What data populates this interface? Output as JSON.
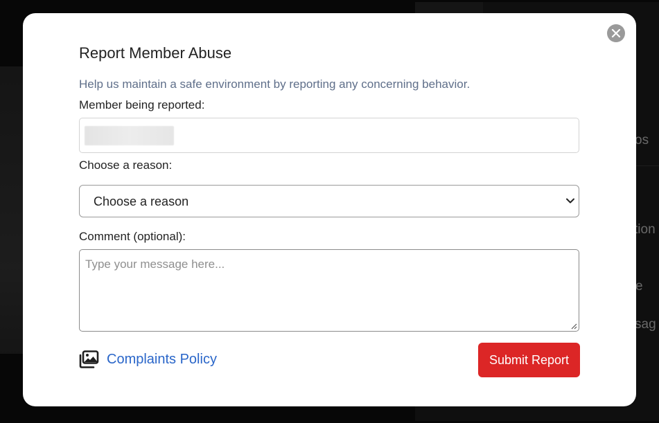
{
  "background": {
    "fragments": [
      "os",
      "tion",
      "e",
      "sag"
    ]
  },
  "modal": {
    "title": "Report Member Abuse",
    "subtitle": "Help us maintain a safe environment by reporting any concerning behavior.",
    "member_label": "Member being reported:",
    "member_value": "",
    "reason_label": "Choose a reason:",
    "reason_selected": "Choose a reason",
    "comment_label": "Comment (optional):",
    "comment_placeholder": "Type your message here...",
    "policy_link": "Complaints Policy",
    "submit_label": "Submit Report"
  },
  "colors": {
    "submit": "#dc2626",
    "link": "#2a66c9",
    "subtitle": "#5f6f8a",
    "close": "#9a9a9a"
  },
  "icons": [
    "close-icon",
    "images-icon",
    "chevron-down-icon",
    "resize-handle-icon"
  ]
}
